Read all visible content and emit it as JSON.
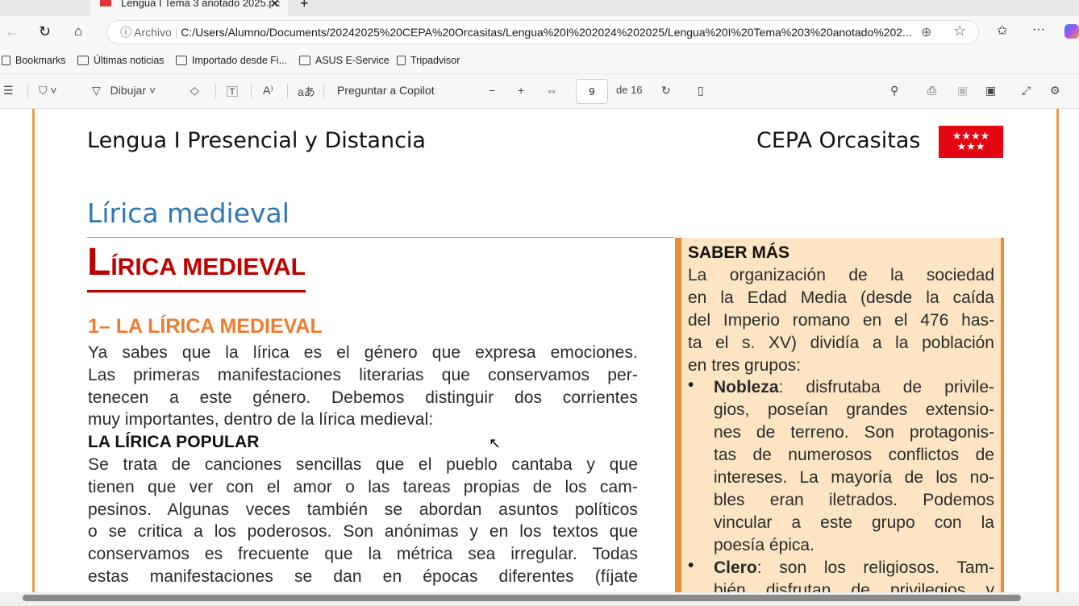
{
  "browser": {
    "tab_title": "Lengua I Tema 3 anotado 2025.pc",
    "address_prefix": "Archivo",
    "url": "C:/Users/Alumno/Documents/20242025%20CEPA%20Orcasitas/Lengua%20I%202024%202025/Lengua%20I%20Tema%203%20anotado%202...",
    "bookmarks": [
      "Bookmarks",
      "Últimas noticias",
      "Importado desde Fi...",
      "ASUS E-Service",
      "Tripadvisor"
    ]
  },
  "pdf_toolbar": {
    "draw_label": "Dibujar",
    "copilot_label": "Preguntar a Copilot",
    "page_current": "9",
    "page_total": "de 16"
  },
  "document": {
    "header_left": "Lengua I Presencial y Distancia",
    "header_right": "CEPA Orcasitas",
    "logo_stars": "★★★★\n★★★",
    "section_title": "Lírica medieval",
    "big_title_first": "L",
    "big_title_rest": "ÍRICA MEDIEVAL",
    "subheading": "1– LA LÍRICA MEDIEVAL",
    "para1": [
      "Ya sabes que la lírica es el género que expresa emociones.",
      "Las primeras manifestaciones literarias que conservamos per-",
      "tenecen a este género. Debemos distinguir dos corrientes",
      "muy importantes, dentro de la lírica medieval:"
    ],
    "popular_heading": "LA LÍRICA POPULAR",
    "para2": [
      "Se trata de canciones sencillas que el pueblo cantaba y que",
      "tienen que ver con el amor o las tareas propias de los cam-",
      "pesinos. Algunas veces también se abordan asuntos políticos",
      "o se critica a los poderosos. Son anónimas y en los textos que",
      "conservamos es frecuente que la métrica sea irregular. Todas",
      "estas manifestaciones se dan en épocas diferentes (fíjate"
    ],
    "sidebar": {
      "title": "SABER MÁS",
      "intro": [
        "La organización de la sociedad",
        "en la Edad Media (desde la caída",
        "del Imperio romano en el 476 has-",
        "ta el s. XV) dividía a la población",
        "en tres grupos:"
      ],
      "b1_term": "Nobleza",
      "b1_first": ": disfrutaba de privile-",
      "b1_lines": [
        "gios, poseían grandes extensio-",
        "nes de terreno. Son protagonis-",
        "tas de numerosos conflictos de",
        "intereses. La mayoría de los no-",
        "bles eran iletrados. Podemos",
        "vincular a este grupo con la",
        "poesía épica."
      ],
      "b2_term": "Clero",
      "b2_first": ": son los religiosos. Tam-",
      "b2_cut": "bién disfrutan de privilegios y"
    }
  }
}
